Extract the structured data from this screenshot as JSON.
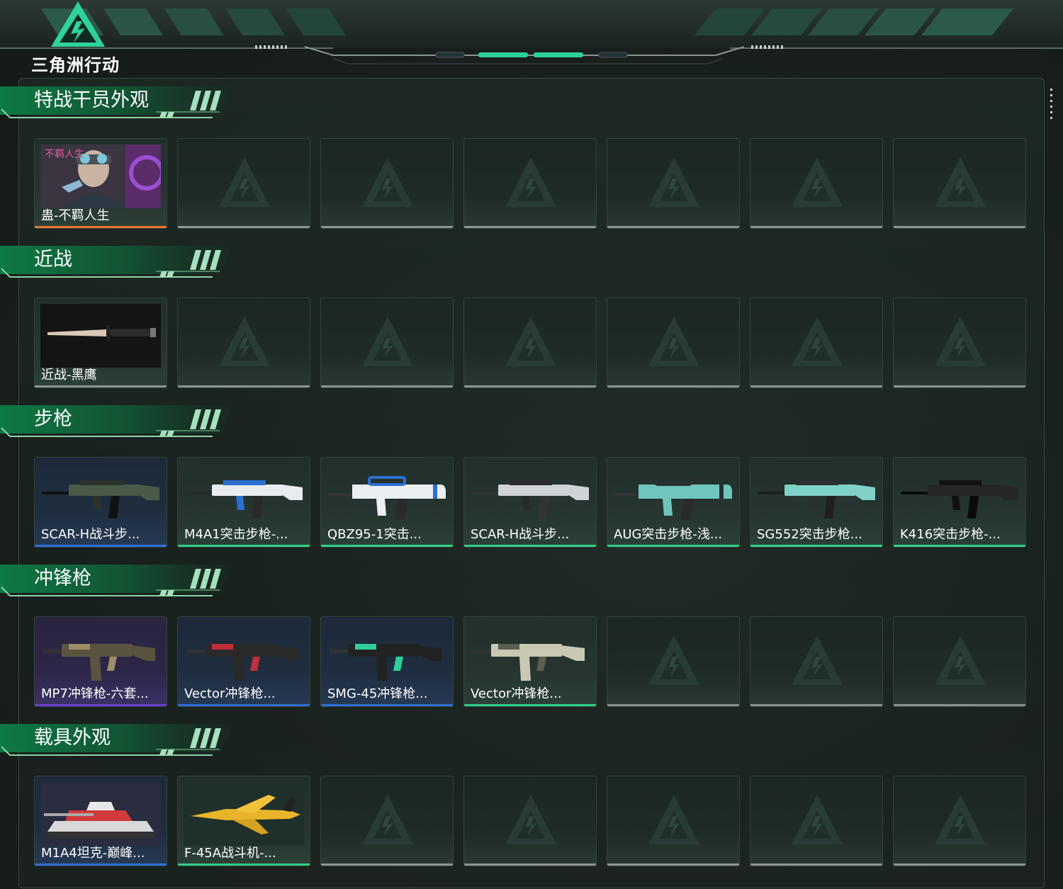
{
  "app": {
    "logo_text": "三角洲行动"
  },
  "colors": {
    "orange": "#e9742a",
    "blue": "#2f6fd6",
    "green": "#2fcf86",
    "purple": "#6a3fd0",
    "grey": "#8b9491"
  },
  "sections": [
    {
      "title": "特战干员外观",
      "items": [
        {
          "label": "蛊-不羁人生",
          "rarity": "orange",
          "icon": "operator-portrait"
        },
        {
          "label": "",
          "empty": true
        },
        {
          "label": "",
          "empty": true
        },
        {
          "label": "",
          "empty": true
        },
        {
          "label": "",
          "empty": true
        },
        {
          "label": "",
          "empty": true
        },
        {
          "label": "",
          "empty": true
        }
      ]
    },
    {
      "title": "近战",
      "items": [
        {
          "label": "近战-黑鹰",
          "rarity": "grey",
          "icon": "knife"
        },
        {
          "label": "",
          "empty": true
        },
        {
          "label": "",
          "empty": true
        },
        {
          "label": "",
          "empty": true
        },
        {
          "label": "",
          "empty": true
        },
        {
          "label": "",
          "empty": true
        },
        {
          "label": "",
          "empty": true
        }
      ]
    },
    {
      "title": "步枪",
      "items": [
        {
          "label": "SCAR-H战斗步...",
          "rarity": "blue",
          "icon": "rifle-green"
        },
        {
          "label": "M4A1突击步枪-...",
          "rarity": "green",
          "icon": "rifle-white-blue"
        },
        {
          "label": "QBZ95-1突击...",
          "rarity": "green",
          "icon": "bullpup-white-blue"
        },
        {
          "label": "SCAR-H战斗步...",
          "rarity": "green",
          "icon": "rifle-white"
        },
        {
          "label": "AUG突击步枪-浅...",
          "rarity": "green",
          "icon": "bullpup-teal"
        },
        {
          "label": "SG552突击步枪...",
          "rarity": "green",
          "icon": "rifle-teal"
        },
        {
          "label": "K416突击步枪-...",
          "rarity": "green",
          "icon": "rifle-black"
        }
      ]
    },
    {
      "title": "冲锋枪",
      "items": [
        {
          "label": "MP7冲锋枪-六套...",
          "rarity": "purple",
          "icon": "smg-tan"
        },
        {
          "label": "Vector冲锋枪...",
          "rarity": "blue",
          "icon": "smg-red"
        },
        {
          "label": "SMG-45冲锋枪...",
          "rarity": "blue",
          "icon": "smg-dark"
        },
        {
          "label": "Vector冲锋枪...",
          "rarity": "green",
          "icon": "smg-camo"
        },
        {
          "label": "",
          "empty": true
        },
        {
          "label": "",
          "empty": true
        },
        {
          "label": "",
          "empty": true
        }
      ]
    },
    {
      "title": "载具外观",
      "items": [
        {
          "label": "M1A4坦克-巅峰...",
          "rarity": "blue",
          "icon": "tank"
        },
        {
          "label": "F-45A战斗机-...",
          "rarity": "green",
          "icon": "jet"
        },
        {
          "label": "",
          "empty": true
        },
        {
          "label": "",
          "empty": true
        },
        {
          "label": "",
          "empty": true
        },
        {
          "label": "",
          "empty": true
        },
        {
          "label": "",
          "empty": true
        }
      ]
    }
  ]
}
